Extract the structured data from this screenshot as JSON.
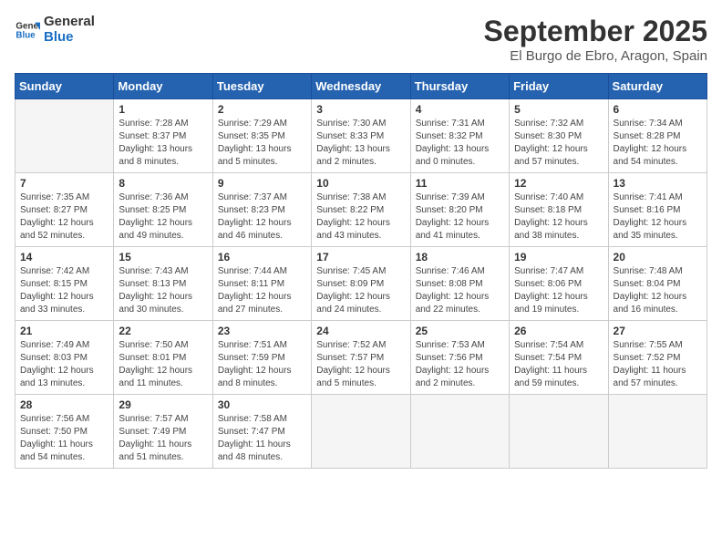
{
  "logo": {
    "line1": "General",
    "line2": "Blue"
  },
  "title": "September 2025",
  "subtitle": "El Burgo de Ebro, Aragon, Spain",
  "weekdays": [
    "Sunday",
    "Monday",
    "Tuesday",
    "Wednesday",
    "Thursday",
    "Friday",
    "Saturday"
  ],
  "weeks": [
    [
      {
        "day": "",
        "info": ""
      },
      {
        "day": "1",
        "info": "Sunrise: 7:28 AM\nSunset: 8:37 PM\nDaylight: 13 hours\nand 8 minutes."
      },
      {
        "day": "2",
        "info": "Sunrise: 7:29 AM\nSunset: 8:35 PM\nDaylight: 13 hours\nand 5 minutes."
      },
      {
        "day": "3",
        "info": "Sunrise: 7:30 AM\nSunset: 8:33 PM\nDaylight: 13 hours\nand 2 minutes."
      },
      {
        "day": "4",
        "info": "Sunrise: 7:31 AM\nSunset: 8:32 PM\nDaylight: 13 hours\nand 0 minutes."
      },
      {
        "day": "5",
        "info": "Sunrise: 7:32 AM\nSunset: 8:30 PM\nDaylight: 12 hours\nand 57 minutes."
      },
      {
        "day": "6",
        "info": "Sunrise: 7:34 AM\nSunset: 8:28 PM\nDaylight: 12 hours\nand 54 minutes."
      }
    ],
    [
      {
        "day": "7",
        "info": "Sunrise: 7:35 AM\nSunset: 8:27 PM\nDaylight: 12 hours\nand 52 minutes."
      },
      {
        "day": "8",
        "info": "Sunrise: 7:36 AM\nSunset: 8:25 PM\nDaylight: 12 hours\nand 49 minutes."
      },
      {
        "day": "9",
        "info": "Sunrise: 7:37 AM\nSunset: 8:23 PM\nDaylight: 12 hours\nand 46 minutes."
      },
      {
        "day": "10",
        "info": "Sunrise: 7:38 AM\nSunset: 8:22 PM\nDaylight: 12 hours\nand 43 minutes."
      },
      {
        "day": "11",
        "info": "Sunrise: 7:39 AM\nSunset: 8:20 PM\nDaylight: 12 hours\nand 41 minutes."
      },
      {
        "day": "12",
        "info": "Sunrise: 7:40 AM\nSunset: 8:18 PM\nDaylight: 12 hours\nand 38 minutes."
      },
      {
        "day": "13",
        "info": "Sunrise: 7:41 AM\nSunset: 8:16 PM\nDaylight: 12 hours\nand 35 minutes."
      }
    ],
    [
      {
        "day": "14",
        "info": "Sunrise: 7:42 AM\nSunset: 8:15 PM\nDaylight: 12 hours\nand 33 minutes."
      },
      {
        "day": "15",
        "info": "Sunrise: 7:43 AM\nSunset: 8:13 PM\nDaylight: 12 hours\nand 30 minutes."
      },
      {
        "day": "16",
        "info": "Sunrise: 7:44 AM\nSunset: 8:11 PM\nDaylight: 12 hours\nand 27 minutes."
      },
      {
        "day": "17",
        "info": "Sunrise: 7:45 AM\nSunset: 8:09 PM\nDaylight: 12 hours\nand 24 minutes."
      },
      {
        "day": "18",
        "info": "Sunrise: 7:46 AM\nSunset: 8:08 PM\nDaylight: 12 hours\nand 22 minutes."
      },
      {
        "day": "19",
        "info": "Sunrise: 7:47 AM\nSunset: 8:06 PM\nDaylight: 12 hours\nand 19 minutes."
      },
      {
        "day": "20",
        "info": "Sunrise: 7:48 AM\nSunset: 8:04 PM\nDaylight: 12 hours\nand 16 minutes."
      }
    ],
    [
      {
        "day": "21",
        "info": "Sunrise: 7:49 AM\nSunset: 8:03 PM\nDaylight: 12 hours\nand 13 minutes."
      },
      {
        "day": "22",
        "info": "Sunrise: 7:50 AM\nSunset: 8:01 PM\nDaylight: 12 hours\nand 11 minutes."
      },
      {
        "day": "23",
        "info": "Sunrise: 7:51 AM\nSunset: 7:59 PM\nDaylight: 12 hours\nand 8 minutes."
      },
      {
        "day": "24",
        "info": "Sunrise: 7:52 AM\nSunset: 7:57 PM\nDaylight: 12 hours\nand 5 minutes."
      },
      {
        "day": "25",
        "info": "Sunrise: 7:53 AM\nSunset: 7:56 PM\nDaylight: 12 hours\nand 2 minutes."
      },
      {
        "day": "26",
        "info": "Sunrise: 7:54 AM\nSunset: 7:54 PM\nDaylight: 11 hours\nand 59 minutes."
      },
      {
        "day": "27",
        "info": "Sunrise: 7:55 AM\nSunset: 7:52 PM\nDaylight: 11 hours\nand 57 minutes."
      }
    ],
    [
      {
        "day": "28",
        "info": "Sunrise: 7:56 AM\nSunset: 7:50 PM\nDaylight: 11 hours\nand 54 minutes."
      },
      {
        "day": "29",
        "info": "Sunrise: 7:57 AM\nSunset: 7:49 PM\nDaylight: 11 hours\nand 51 minutes."
      },
      {
        "day": "30",
        "info": "Sunrise: 7:58 AM\nSunset: 7:47 PM\nDaylight: 11 hours\nand 48 minutes."
      },
      {
        "day": "",
        "info": ""
      },
      {
        "day": "",
        "info": ""
      },
      {
        "day": "",
        "info": ""
      },
      {
        "day": "",
        "info": ""
      }
    ]
  ]
}
